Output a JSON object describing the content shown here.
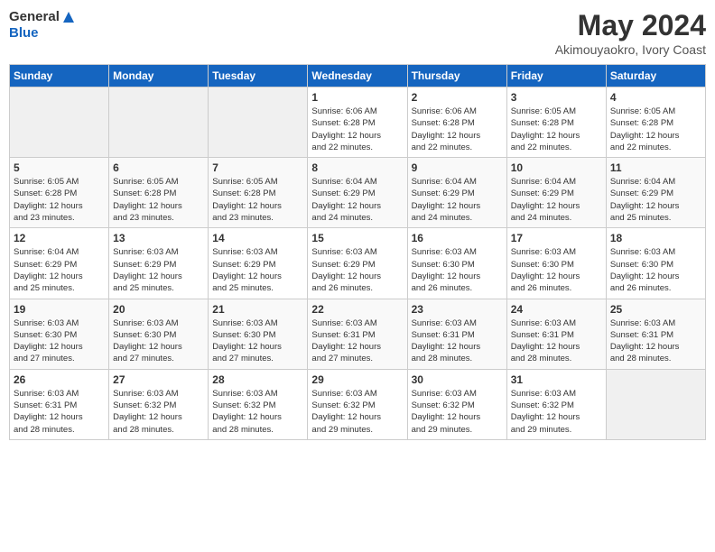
{
  "header": {
    "logo_general": "General",
    "logo_blue": "Blue",
    "title": "May 2024",
    "subtitle": "Akimouyaokro, Ivory Coast"
  },
  "calendar": {
    "days_of_week": [
      "Sunday",
      "Monday",
      "Tuesday",
      "Wednesday",
      "Thursday",
      "Friday",
      "Saturday"
    ],
    "weeks": [
      [
        {
          "day": "",
          "info": ""
        },
        {
          "day": "",
          "info": ""
        },
        {
          "day": "",
          "info": ""
        },
        {
          "day": "1",
          "info": "Sunrise: 6:06 AM\nSunset: 6:28 PM\nDaylight: 12 hours\nand 22 minutes."
        },
        {
          "day": "2",
          "info": "Sunrise: 6:06 AM\nSunset: 6:28 PM\nDaylight: 12 hours\nand 22 minutes."
        },
        {
          "day": "3",
          "info": "Sunrise: 6:05 AM\nSunset: 6:28 PM\nDaylight: 12 hours\nand 22 minutes."
        },
        {
          "day": "4",
          "info": "Sunrise: 6:05 AM\nSunset: 6:28 PM\nDaylight: 12 hours\nand 22 minutes."
        }
      ],
      [
        {
          "day": "5",
          "info": "Sunrise: 6:05 AM\nSunset: 6:28 PM\nDaylight: 12 hours\nand 23 minutes."
        },
        {
          "day": "6",
          "info": "Sunrise: 6:05 AM\nSunset: 6:28 PM\nDaylight: 12 hours\nand 23 minutes."
        },
        {
          "day": "7",
          "info": "Sunrise: 6:05 AM\nSunset: 6:28 PM\nDaylight: 12 hours\nand 23 minutes."
        },
        {
          "day": "8",
          "info": "Sunrise: 6:04 AM\nSunset: 6:29 PM\nDaylight: 12 hours\nand 24 minutes."
        },
        {
          "day": "9",
          "info": "Sunrise: 6:04 AM\nSunset: 6:29 PM\nDaylight: 12 hours\nand 24 minutes."
        },
        {
          "day": "10",
          "info": "Sunrise: 6:04 AM\nSunset: 6:29 PM\nDaylight: 12 hours\nand 24 minutes."
        },
        {
          "day": "11",
          "info": "Sunrise: 6:04 AM\nSunset: 6:29 PM\nDaylight: 12 hours\nand 25 minutes."
        }
      ],
      [
        {
          "day": "12",
          "info": "Sunrise: 6:04 AM\nSunset: 6:29 PM\nDaylight: 12 hours\nand 25 minutes."
        },
        {
          "day": "13",
          "info": "Sunrise: 6:03 AM\nSunset: 6:29 PM\nDaylight: 12 hours\nand 25 minutes."
        },
        {
          "day": "14",
          "info": "Sunrise: 6:03 AM\nSunset: 6:29 PM\nDaylight: 12 hours\nand 25 minutes."
        },
        {
          "day": "15",
          "info": "Sunrise: 6:03 AM\nSunset: 6:29 PM\nDaylight: 12 hours\nand 26 minutes."
        },
        {
          "day": "16",
          "info": "Sunrise: 6:03 AM\nSunset: 6:30 PM\nDaylight: 12 hours\nand 26 minutes."
        },
        {
          "day": "17",
          "info": "Sunrise: 6:03 AM\nSunset: 6:30 PM\nDaylight: 12 hours\nand 26 minutes."
        },
        {
          "day": "18",
          "info": "Sunrise: 6:03 AM\nSunset: 6:30 PM\nDaylight: 12 hours\nand 26 minutes."
        }
      ],
      [
        {
          "day": "19",
          "info": "Sunrise: 6:03 AM\nSunset: 6:30 PM\nDaylight: 12 hours\nand 27 minutes."
        },
        {
          "day": "20",
          "info": "Sunrise: 6:03 AM\nSunset: 6:30 PM\nDaylight: 12 hours\nand 27 minutes."
        },
        {
          "day": "21",
          "info": "Sunrise: 6:03 AM\nSunset: 6:30 PM\nDaylight: 12 hours\nand 27 minutes."
        },
        {
          "day": "22",
          "info": "Sunrise: 6:03 AM\nSunset: 6:31 PM\nDaylight: 12 hours\nand 27 minutes."
        },
        {
          "day": "23",
          "info": "Sunrise: 6:03 AM\nSunset: 6:31 PM\nDaylight: 12 hours\nand 28 minutes."
        },
        {
          "day": "24",
          "info": "Sunrise: 6:03 AM\nSunset: 6:31 PM\nDaylight: 12 hours\nand 28 minutes."
        },
        {
          "day": "25",
          "info": "Sunrise: 6:03 AM\nSunset: 6:31 PM\nDaylight: 12 hours\nand 28 minutes."
        }
      ],
      [
        {
          "day": "26",
          "info": "Sunrise: 6:03 AM\nSunset: 6:31 PM\nDaylight: 12 hours\nand 28 minutes."
        },
        {
          "day": "27",
          "info": "Sunrise: 6:03 AM\nSunset: 6:32 PM\nDaylight: 12 hours\nand 28 minutes."
        },
        {
          "day": "28",
          "info": "Sunrise: 6:03 AM\nSunset: 6:32 PM\nDaylight: 12 hours\nand 28 minutes."
        },
        {
          "day": "29",
          "info": "Sunrise: 6:03 AM\nSunset: 6:32 PM\nDaylight: 12 hours\nand 29 minutes."
        },
        {
          "day": "30",
          "info": "Sunrise: 6:03 AM\nSunset: 6:32 PM\nDaylight: 12 hours\nand 29 minutes."
        },
        {
          "day": "31",
          "info": "Sunrise: 6:03 AM\nSunset: 6:32 PM\nDaylight: 12 hours\nand 29 minutes."
        },
        {
          "day": "",
          "info": ""
        }
      ]
    ]
  }
}
